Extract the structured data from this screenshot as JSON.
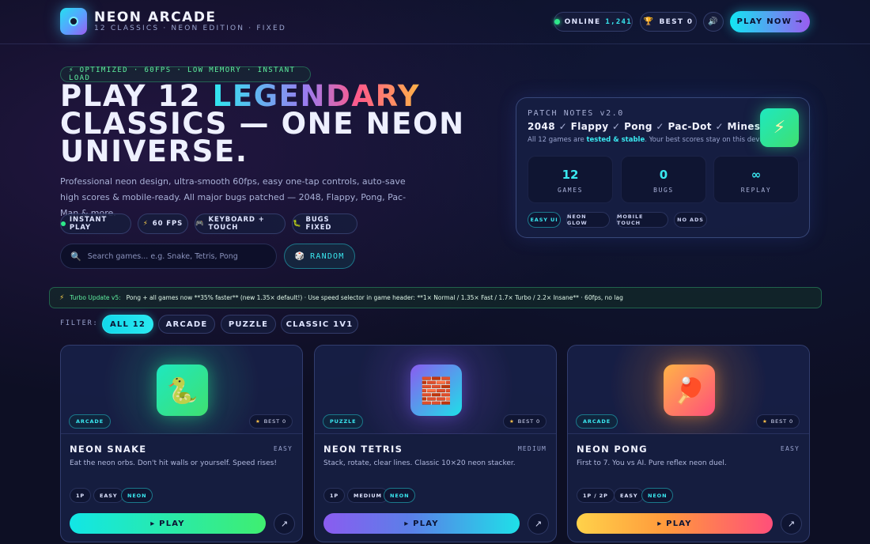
{
  "header": {
    "brand": "NEON ARCADE",
    "subtitle": "12 CLASSICS · NEON EDITION · FIXED",
    "online_label": "ONLINE",
    "online_count": "1,241",
    "best_label": "BEST 0",
    "sound_icon": "speaker-icon",
    "play_now": "PLAY NOW →"
  },
  "hero": {
    "tagline": "⚡ OPTIMIZED · 60FPS · LOW MEMORY · INSTANT LOAD",
    "headline_1": "PLAY 12 ",
    "headline_highlight": "LEGENDARY",
    "headline_2": "CLASSICS — ONE NEON",
    "headline_3": "UNIVERSE.",
    "description": "Professional neon design, ultra-smooth 60fps, easy one-tap controls, auto-save high scores & mobile-ready. All major bugs patched — 2048, Flappy, Pong, Pac-Man & more.",
    "chips": [
      "INSTANT PLAY",
      "60 FPS",
      "KEYBOARD + TOUCH",
      "BUGS FIXED"
    ],
    "chip_icons": [
      "green-dot-icon",
      "bolt-icon",
      "gamepad-icon",
      "bug-icon"
    ],
    "search_placeholder": "Search games... e.g. Snake, Tetris, Pong",
    "random_label": "RANDOM"
  },
  "patch": {
    "title": "PATCH NOTES v2.0",
    "games": [
      "2048",
      "Flappy",
      "Pong",
      "Pac-Dot",
      "Mines"
    ],
    "note_prefix": "All 12 games are ",
    "note_bold": "tested & stable",
    "note_suffix": ". Your best scores stay on this device.",
    "stats": [
      {
        "value": "12",
        "label": "GAMES"
      },
      {
        "value": "0",
        "label": "BUGS"
      },
      {
        "value": "∞",
        "label": "REPLAY"
      }
    ],
    "tags": [
      "EASY UI",
      "NEON GLOW",
      "MOBILE TOUCH",
      "NO ADS"
    ]
  },
  "turbo": {
    "title": "Turbo Update v5:",
    "text": "Pong + all games now **35% faster** (new 1.35× default!) · Use speed selector in game header: **1× Normal / 1.35× Fast / 1.7× Turbo / 2.2× Insane** · 60fps, no lag"
  },
  "filter": {
    "label": "FILTER:",
    "tabs": [
      "ALL 12",
      "ARCADE",
      "PUZZLE",
      "CLASSIC 1V1"
    ],
    "active": "ALL 12"
  },
  "cards": [
    {
      "name": "NEON SNAKE",
      "difficulty": "EASY",
      "category": "ARCADE",
      "best": "BEST 0",
      "description": "Eat the neon orbs. Don't hit walls or yourself. Speed rises!",
      "tags": [
        "1P",
        "EASY",
        "NEON"
      ],
      "play": "▸ PLAY",
      "icon": "snake-icon"
    },
    {
      "name": "NEON TETRIS",
      "difficulty": "MEDIUM",
      "category": "PUZZLE",
      "best": "BEST 0",
      "description": "Stack, rotate, clear lines. Classic 10×20 neon stacker.",
      "tags": [
        "1P",
        "MEDIUM",
        "NEON"
      ],
      "play": "▸ PLAY",
      "icon": "brick-icon"
    },
    {
      "name": "NEON PONG",
      "difficulty": "EASY",
      "category": "ARCADE",
      "best": "BEST 0",
      "description": "First to 7. You vs AI. Pure reflex neon duel.",
      "tags": [
        "1P / 2P",
        "EASY",
        "NEON"
      ],
      "play": "▸ PLAY",
      "icon": "paddle-icon"
    }
  ],
  "colors": {
    "accent_cyan": "#2ae8f0",
    "accent_purple": "#9a5cf0",
    "accent_green": "#2ee88a",
    "background": "#0d0f24"
  }
}
